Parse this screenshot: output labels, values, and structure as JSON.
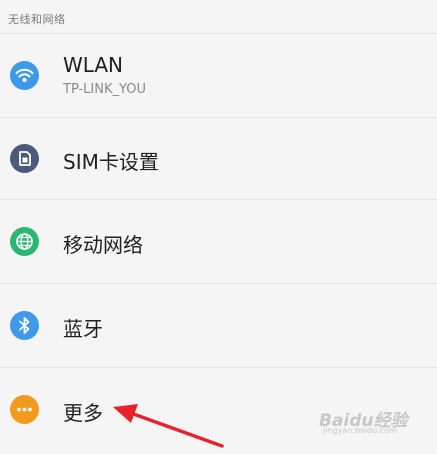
{
  "section": {
    "title": "无线和网络"
  },
  "items": [
    {
      "label": "WLAN",
      "subtitle": "TP-LINK_YOU",
      "icon": "wifi-icon",
      "icon_color": "#3d9ae8"
    },
    {
      "label": "SIM卡设置",
      "icon": "sim-card-icon",
      "icon_color": "#4a5a78"
    },
    {
      "label": "移动网络",
      "icon": "globe-icon",
      "icon_color": "#2bb673"
    },
    {
      "label": "蓝牙",
      "icon": "bluetooth-icon",
      "icon_color": "#3d9ae8"
    },
    {
      "label": "更多",
      "icon": "more-icon",
      "icon_color": "#f39a1e"
    }
  ],
  "watermark": {
    "main": "Baidu经验",
    "sub": "jingyan.baidu.com"
  },
  "colors": {
    "background": "#f5f5f5",
    "annotation_arrow": "#e8222a"
  }
}
